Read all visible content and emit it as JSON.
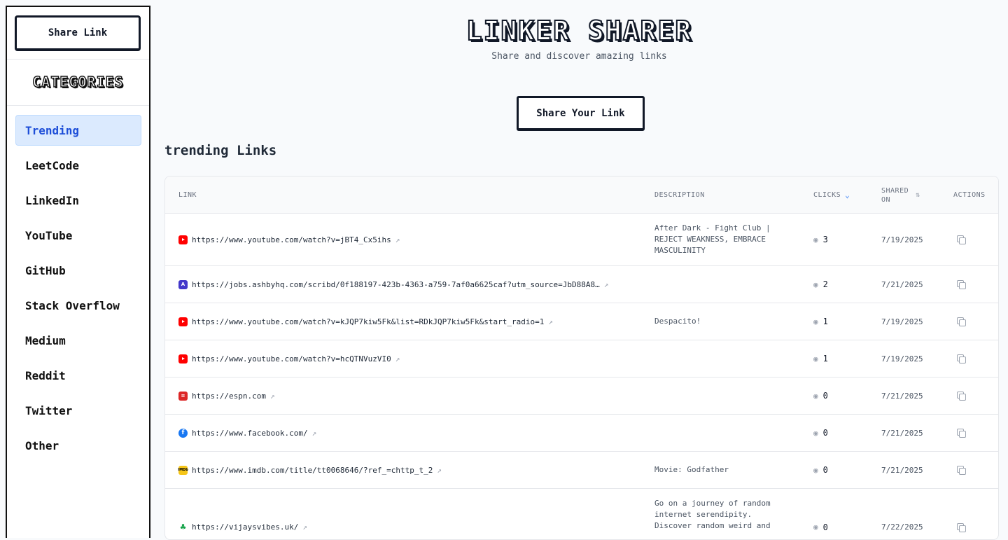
{
  "sidebar": {
    "share_button": "Share Link",
    "categories_title": "CATEGORIES",
    "items": [
      {
        "label": "Trending",
        "active": true
      },
      {
        "label": "LeetCode"
      },
      {
        "label": "LinkedIn"
      },
      {
        "label": "YouTube"
      },
      {
        "label": "GitHub"
      },
      {
        "label": "Stack Overflow"
      },
      {
        "label": "Medium"
      },
      {
        "label": "Reddit"
      },
      {
        "label": "Twitter"
      },
      {
        "label": "Other"
      }
    ]
  },
  "header": {
    "title": "LINKER SHARER",
    "subtitle": "Share and discover amazing links",
    "share_your_link": "Share Your Link"
  },
  "section_title": "trending Links",
  "table": {
    "columns": {
      "link": "LINK",
      "description": "DESCRIPTION",
      "clicks": "CLICKS",
      "shared_line1": "SHARED",
      "shared_line2": "ON",
      "actions": "ACTIONS"
    },
    "rows": [
      {
        "icon": "youtube-favicon-icon",
        "url": "https://www.youtube.com/watch?v=jBT4_Cx5ihs",
        "description": "After Dark - Fight Club | REJECT WEAKNESS, EMBRACE MASCULINITY",
        "clicks": "3",
        "date": "7/19/2025"
      },
      {
        "icon": "ashby-favicon-icon",
        "url": "https://jobs.ashbyhq.com/scribd/0f188197-423b-4363-a759-7af0a6625caf?utm_source=JbD88A8…",
        "description": "",
        "clicks": "2",
        "date": "7/21/2025"
      },
      {
        "icon": "youtube-favicon-icon",
        "url": "https://www.youtube.com/watch?v=kJQP7kiw5Fk&list=RDkJQP7kiw5Fk&start_radio=1",
        "description": "Despacito!",
        "clicks": "1",
        "date": "7/19/2025"
      },
      {
        "icon": "youtube-favicon-icon",
        "url": "https://www.youtube.com/watch?v=hcQTNVuzVI0",
        "description": "",
        "clicks": "1",
        "date": "7/19/2025"
      },
      {
        "icon": "espn-favicon-icon",
        "url": "https://espn.com",
        "description": "",
        "clicks": "0",
        "date": "7/21/2025"
      },
      {
        "icon": "facebook-favicon-icon",
        "url": "https://www.facebook.com/",
        "description": "",
        "clicks": "0",
        "date": "7/21/2025"
      },
      {
        "icon": "imdb-favicon-icon",
        "url": "https://www.imdb.com/title/tt0068646/?ref_=chttp_t_2",
        "description": "Movie: Godfather",
        "clicks": "0",
        "date": "7/21/2025"
      },
      {
        "icon": "vijaysvibes-favicon-icon",
        "url": "https://vijaysvibes.uk/",
        "description": "Go on a journey of random internet serendipity. Discover random weird and",
        "clicks": "0",
        "date": "7/22/2025"
      }
    ]
  }
}
